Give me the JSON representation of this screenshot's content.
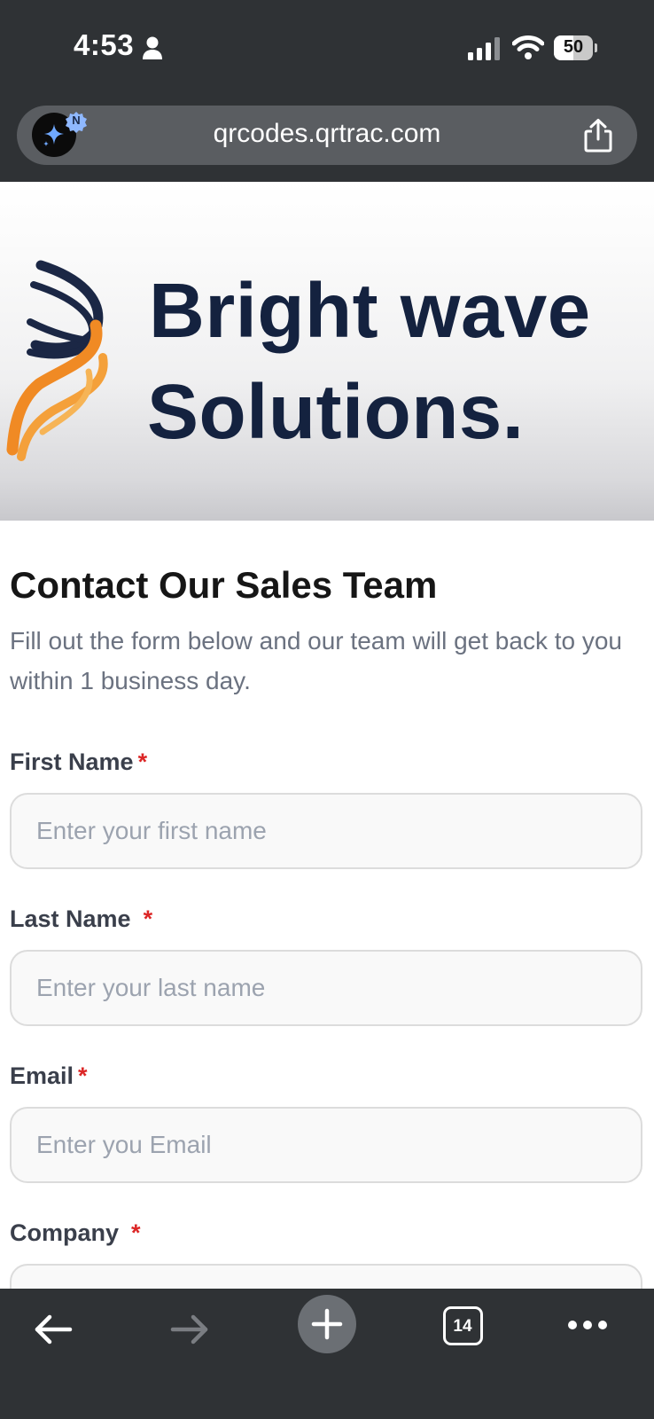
{
  "status_bar": {
    "time": "4:53",
    "battery": "50"
  },
  "browser": {
    "url": "qrcodes.qrtrac.com",
    "ai_badge_letter": "N",
    "open_tabs": "14"
  },
  "banner": {
    "brand_line1": "Bright wave",
    "brand_line2": "Solutions."
  },
  "form": {
    "title": "Contact Our Sales Team",
    "subtitle": "Fill out the form below and our team will get back to you within 1 business day.",
    "required_marker": "*",
    "fields": [
      {
        "label": "First Name",
        "placeholder": "Enter your first name"
      },
      {
        "label": "Last Name",
        "placeholder": "Enter your last name"
      },
      {
        "label": "Email",
        "placeholder": "Enter you Email"
      },
      {
        "label": "Company",
        "placeholder": ""
      }
    ]
  },
  "colors": {
    "chrome_bg": "#2f3235",
    "brand_navy": "#14223f",
    "brand_orange": "#f08a24",
    "required_red": "#dc2626"
  }
}
